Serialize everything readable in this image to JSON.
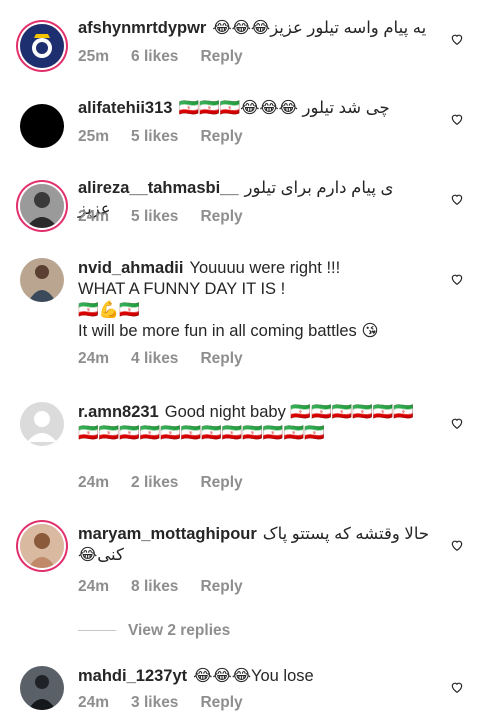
{
  "comments": [
    {
      "username": "afshynmrtdypwr",
      "text": "یه پیام واسه تیلور عزیز😂😂😂",
      "time": "25m",
      "likes": "6 likes",
      "reply": "Reply",
      "avatar": "real-madrid-logo"
    },
    {
      "username": "alifatehii313",
      "text": "چی شد تیلور 😂😂😂🇮🇷🇮🇷🇮🇷",
      "time": "25m",
      "likes": "5 likes",
      "reply": "Reply",
      "avatar": "black-circle"
    },
    {
      "username": "alireza__tahmasbi__",
      "text": "ی پیام دارم برای تیلور عزیز",
      "time": "24m",
      "likes": "5 likes",
      "reply": "Reply",
      "avatar": "person-photo"
    },
    {
      "username": "nvid_ahmadii",
      "text": "Youuuu were right !!!\nWHAT A FUNNY DAY IT IS !\n🇮🇷💪🇮🇷\n It will be more fun in all coming battles 😘",
      "time": "24m",
      "likes": "4 likes",
      "reply": "Reply",
      "avatar": "person-photo"
    },
    {
      "username": "r.amn8231",
      "text": "Good night baby 🇮🇷🇮🇷🇮🇷🇮🇷🇮🇷🇮🇷🇮🇷🇮🇷🇮🇷🇮🇷🇮🇷🇮🇷🇮🇷🇮🇷🇮🇷🇮🇷🇮🇷🇮🇷",
      "time": "24m",
      "likes": "2 likes",
      "reply": "Reply",
      "avatar": "default-user"
    },
    {
      "username": "maryam_mottaghipour",
      "text": "حالا وقتشه که پستتو پاک کنی😂",
      "time": "24m",
      "likes": "8 likes",
      "reply": "Reply",
      "avatar": "person-photo"
    },
    {
      "username": "mahdi_1237yt",
      "text": "😂😂😂You lose",
      "time": "24m",
      "likes": "3 likes",
      "reply": "Reply",
      "avatar": "person-photo"
    }
  ],
  "view_replies": "View 2 replies",
  "colors": {
    "text": "#262626",
    "meta": "#8e8e8e",
    "ring": "#e1306c",
    "iran_green": "#239f40",
    "iran_red": "#da0000"
  }
}
